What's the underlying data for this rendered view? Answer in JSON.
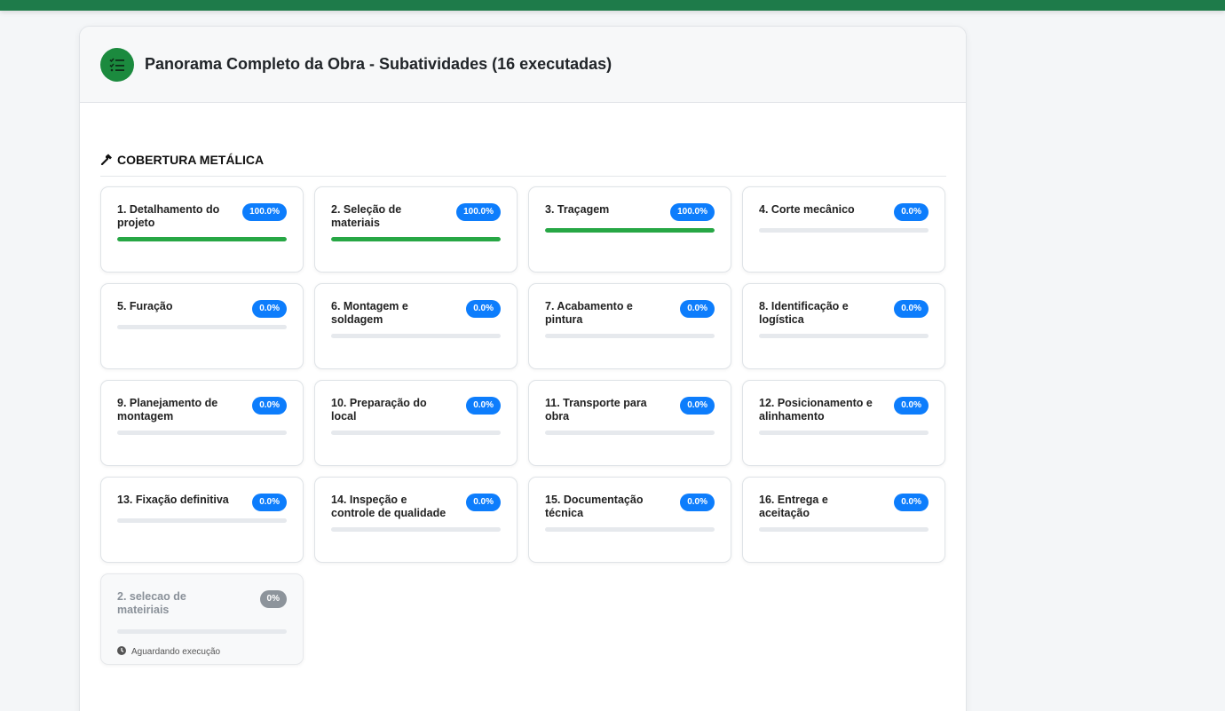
{
  "header": {
    "title": "Panorama Completo da Obra - Subatividades (16 executadas)",
    "icon": "tasks-icon"
  },
  "section": {
    "title": "COBERTURA METÁLICA",
    "icon": "hammer-icon"
  },
  "colors": {
    "brand": "#1e7b4a",
    "badge": "#0d7dfc",
    "progress": "#27a745",
    "pending_badge": "#8d949b"
  },
  "subactivities": [
    {
      "name": "1. Detalhamento do projeto",
      "badge": "100.0%",
      "progress": 1.0
    },
    {
      "name": "2. Seleção de materiais",
      "badge": "100.0%",
      "progress": 1.0
    },
    {
      "name": "3. Traçagem",
      "badge": "100.0%",
      "progress": 1.0
    },
    {
      "name": "4. Corte mecânico",
      "badge": "0.0%",
      "progress": 0
    },
    {
      "name": "5. Furação",
      "badge": "0.0%",
      "progress": 0
    },
    {
      "name": "6. Montagem e soldagem",
      "badge": "0.0%",
      "progress": 0
    },
    {
      "name": "7. Acabamento e pintura",
      "badge": "0.0%",
      "progress": 0
    },
    {
      "name": "8. Identificação e logística",
      "badge": "0.0%",
      "progress": 0
    },
    {
      "name": "9. Planejamento de montagem",
      "badge": "0.0%",
      "progress": 0
    },
    {
      "name": "10. Preparação do local",
      "badge": "0.0%",
      "progress": 0
    },
    {
      "name": "11. Transporte para obra",
      "badge": "0.0%",
      "progress": 0
    },
    {
      "name": "12. Posicionamento e alinhamento",
      "badge": "0.0%",
      "progress": 0
    },
    {
      "name": "13. Fixação definitiva",
      "badge": "0.0%",
      "progress": 0
    },
    {
      "name": "14. Inspeção e controle de qualidade",
      "badge": "0.0%",
      "progress": 0
    },
    {
      "name": "15. Documentação técnica",
      "badge": "0.0%",
      "progress": 0
    },
    {
      "name": "16. Entrega e aceitação",
      "badge": "0.0%",
      "progress": 0
    }
  ],
  "pending": {
    "name": "2. selecao de mateiriais",
    "badge": "0%",
    "progress": 0,
    "status": "Aguardando execução"
  }
}
